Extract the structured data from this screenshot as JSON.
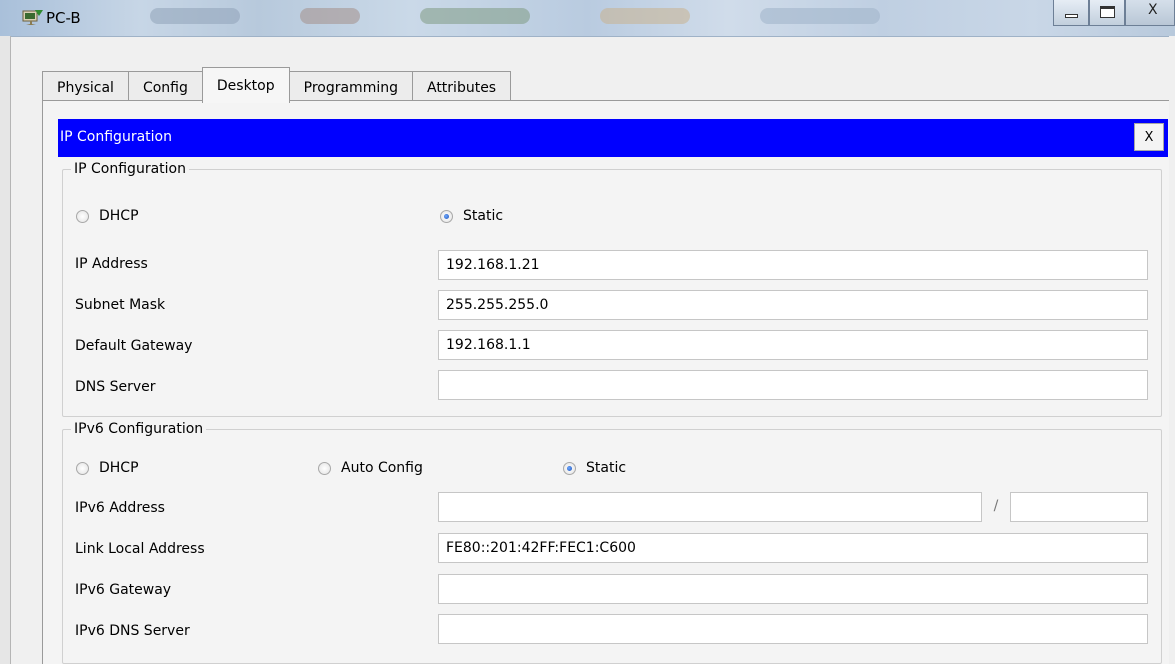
{
  "window": {
    "title": "PC-B",
    "icon": "packet-tracer-pc-icon",
    "controls": {
      "minimize_icon": "minimize-icon",
      "maximize_icon": "maximize-icon",
      "close_label": "X"
    }
  },
  "tabs": [
    {
      "label": "Physical",
      "active": false
    },
    {
      "label": "Config",
      "active": false
    },
    {
      "label": "Desktop",
      "active": true
    },
    {
      "label": "Programming",
      "active": false
    },
    {
      "label": "Attributes",
      "active": false
    }
  ],
  "ip_config": {
    "header_title": "IP Configuration",
    "close_label": "X",
    "header_color": "#0000ff",
    "ipv4": {
      "legend": "IP Configuration",
      "dhcp_label": "DHCP",
      "static_label": "Static",
      "selected": "Static",
      "ip_address_label": "IP Address",
      "ip_address": "192.168.1.21",
      "subnet_mask_label": "Subnet Mask",
      "subnet_mask": "255.255.255.0",
      "default_gateway_label": "Default Gateway",
      "default_gateway": "192.168.1.1",
      "dns_server_label": "DNS Server",
      "dns_server": ""
    },
    "ipv6": {
      "legend": "IPv6 Configuration",
      "dhcp_label": "DHCP",
      "auto_config_label": "Auto Config",
      "static_label": "Static",
      "selected": "Static",
      "ipv6_address_label": "IPv6 Address",
      "ipv6_address": "",
      "prefix_separator": "/",
      "prefix_length": "",
      "link_local_label": "Link Local Address",
      "link_local_address": "FE80::201:42FF:FEC1:C600",
      "ipv6_gateway_label": "IPv6 Gateway",
      "ipv6_gateway": "",
      "ipv6_dns_label": "IPv6 DNS Server",
      "ipv6_dns": ""
    }
  }
}
